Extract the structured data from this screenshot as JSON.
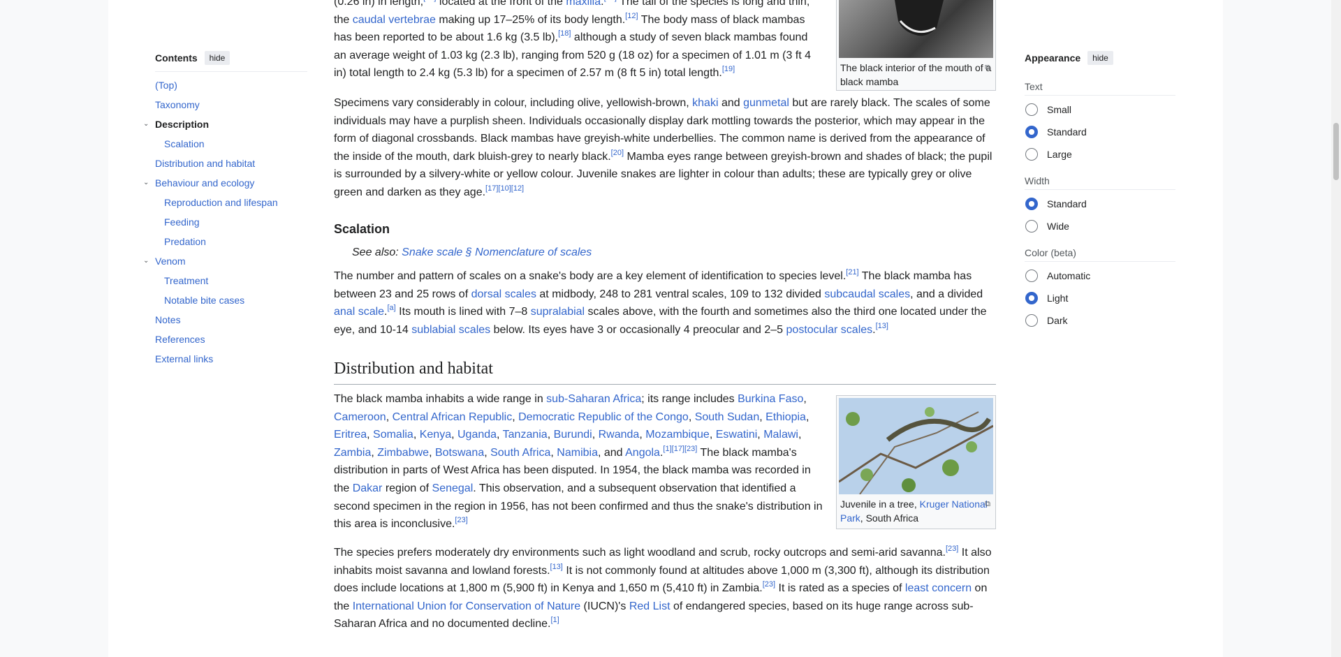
{
  "toc": {
    "title": "Contents",
    "hide": "hide",
    "items": [
      {
        "label": "(Top)",
        "sub": false,
        "active": false,
        "chev": false
      },
      {
        "label": "Taxonomy",
        "sub": false,
        "active": false,
        "chev": false
      },
      {
        "label": "Description",
        "sub": false,
        "active": true,
        "chev": true
      },
      {
        "label": "Scalation",
        "sub": true,
        "active": false,
        "chev": false
      },
      {
        "label": "Distribution and habitat",
        "sub": false,
        "active": false,
        "chev": false
      },
      {
        "label": "Behaviour and ecology",
        "sub": false,
        "active": false,
        "chev": true
      },
      {
        "label": "Reproduction and lifespan",
        "sub": true,
        "active": false,
        "chev": false
      },
      {
        "label": "Feeding",
        "sub": true,
        "active": false,
        "chev": false
      },
      {
        "label": "Predation",
        "sub": true,
        "active": false,
        "chev": false
      },
      {
        "label": "Venom",
        "sub": false,
        "active": false,
        "chev": true
      },
      {
        "label": "Treatment",
        "sub": true,
        "active": false,
        "chev": false
      },
      {
        "label": "Notable bite cases",
        "sub": true,
        "active": false,
        "chev": false
      },
      {
        "label": "Notes",
        "sub": false,
        "active": false,
        "chev": false
      },
      {
        "label": "References",
        "sub": false,
        "active": false,
        "chev": false
      },
      {
        "label": "External links",
        "sub": false,
        "active": false,
        "chev": false
      }
    ]
  },
  "appearance": {
    "title": "Appearance",
    "hide": "hide",
    "sections": [
      {
        "label": "Text",
        "options": [
          {
            "label": "Small",
            "on": false
          },
          {
            "label": "Standard",
            "on": true
          },
          {
            "label": "Large",
            "on": false
          }
        ]
      },
      {
        "label": "Width",
        "options": [
          {
            "label": "Standard",
            "on": true
          },
          {
            "label": "Wide",
            "on": false
          }
        ]
      },
      {
        "label": "Color (beta)",
        "options": [
          {
            "label": "Automatic",
            "on": false
          },
          {
            "label": "Light",
            "on": true
          },
          {
            "label": "Dark",
            "on": false
          }
        ]
      }
    ]
  },
  "figures": {
    "mouth_caption": "The black interior of the mouth of a black mamba",
    "tree_caption_pre": "Juvenile in a tree, ",
    "tree_caption_link": "Kruger National Park",
    "tree_caption_post": ", South Africa"
  },
  "headings": {
    "scalation": "Scalation",
    "distribution": "Distribution and habitat"
  },
  "see_also": {
    "prefix": "See also: ",
    "link": "Snake scale § Nomenclature of scales"
  },
  "paragraphs": [
    [
      {
        "t": "(0.26 in) in length,"
      },
      {
        "s": "[17]"
      },
      {
        "t": " located at the front of the "
      },
      {
        "l": "maxilla"
      },
      {
        "t": "."
      },
      {
        "s": "[16]"
      },
      {
        "t": " The tail of the species is long and thin, the "
      },
      {
        "l": "caudal vertebrae"
      },
      {
        "t": " making up 17–25% of its body length."
      },
      {
        "s": "[12]"
      },
      {
        "t": " The body mass of black mambas has been reported to be about 1.6 kg (3.5 lb),"
      },
      {
        "s": "[18]"
      },
      {
        "t": " although a study of seven black mambas found an average weight of 1.03 kg (2.3 lb), ranging from 520 g (18 oz) for a specimen of 1.01 m (3 ft 4 in) total length to 2.4 kg (5.3 lb) for a specimen of 2.57 m (8 ft 5 in) total length."
      },
      {
        "s": "[19]"
      }
    ],
    [
      {
        "t": "Specimens vary considerably in colour, including olive, yellowish-brown, "
      },
      {
        "l": "khaki"
      },
      {
        "t": " and "
      },
      {
        "l": "gunmetal"
      },
      {
        "t": " but are rarely black. The scales of some individuals may have a purplish sheen. Individuals occasionally display dark mottling towards the posterior, which may appear in the form of diagonal crossbands. Black mambas have greyish-white underbellies. The common name is derived from the appearance of the inside of the mouth, dark bluish-grey to nearly black."
      },
      {
        "s": "[20]"
      },
      {
        "t": " Mamba eyes range between greyish-brown and shades of black; the pupil is surrounded by a silvery-white or yellow colour. Juvenile snakes are lighter in colour than adults; these are typically grey or olive green and darken as they age."
      },
      {
        "s": "[17]"
      },
      {
        "s": "[10]"
      },
      {
        "s": "[12]"
      }
    ],
    [
      {
        "t": "The number and pattern of scales on a snake's body are a key element of identification to species level."
      },
      {
        "s": "[21]"
      },
      {
        "t": " The black mamba has between 23 and 25 rows of "
      },
      {
        "l": "dorsal scales"
      },
      {
        "t": " at midbody, 248 to 281 ventral scales, 109 to 132 divided "
      },
      {
        "l": "subcaudal scales"
      },
      {
        "t": ", and a divided "
      },
      {
        "l": "anal scale"
      },
      {
        "t": "."
      },
      {
        "s": "[a]"
      },
      {
        "t": " Its mouth is lined with 7–8 "
      },
      {
        "l": "supralabial"
      },
      {
        "t": " scales above, with the fourth and sometimes also the third one located under the eye, and 10-14 "
      },
      {
        "l": "sublabial scales"
      },
      {
        "t": " below. Its eyes have 3 or occasionally 4 preocular and 2–5 "
      },
      {
        "l": "postocular scales"
      },
      {
        "t": "."
      },
      {
        "s": "[13]"
      }
    ],
    [
      {
        "t": "The black mamba inhabits a wide range in "
      },
      {
        "l": "sub-Saharan Africa"
      },
      {
        "t": "; its range includes "
      },
      {
        "l": "Burkina Faso"
      },
      {
        "t": ", "
      },
      {
        "l": "Cameroon"
      },
      {
        "t": ", "
      },
      {
        "l": "Central African Republic"
      },
      {
        "t": ", "
      },
      {
        "l": "Democratic Republic of the Congo"
      },
      {
        "t": ", "
      },
      {
        "l": "South Sudan"
      },
      {
        "t": ", "
      },
      {
        "l": "Ethiopia"
      },
      {
        "t": ", "
      },
      {
        "l": "Eritrea"
      },
      {
        "t": ", "
      },
      {
        "l": "Somalia"
      },
      {
        "t": ", "
      },
      {
        "l": "Kenya"
      },
      {
        "t": ", "
      },
      {
        "l": "Uganda"
      },
      {
        "t": ", "
      },
      {
        "l": "Tanzania"
      },
      {
        "t": ", "
      },
      {
        "l": "Burundi"
      },
      {
        "t": ", "
      },
      {
        "l": "Rwanda"
      },
      {
        "t": ", "
      },
      {
        "l": "Mozambique"
      },
      {
        "t": ", "
      },
      {
        "l": "Eswatini"
      },
      {
        "t": ", "
      },
      {
        "l": "Malawi"
      },
      {
        "t": ", "
      },
      {
        "l": "Zambia"
      },
      {
        "t": ", "
      },
      {
        "l": "Zimbabwe"
      },
      {
        "t": ", "
      },
      {
        "l": "Botswana"
      },
      {
        "t": ", "
      },
      {
        "l": "South Africa"
      },
      {
        "t": ", "
      },
      {
        "l": "Namibia"
      },
      {
        "t": ", and "
      },
      {
        "l": "Angola"
      },
      {
        "t": "."
      },
      {
        "s": "[1]"
      },
      {
        "s": "[17]"
      },
      {
        "s": "[23]"
      },
      {
        "t": " The black mamba's distribution in parts of West Africa has been disputed. In 1954, the black mamba was recorded in the "
      },
      {
        "l": "Dakar"
      },
      {
        "t": " region of "
      },
      {
        "l": "Senegal"
      },
      {
        "t": ". This observation, and a subsequent observation that identified a second specimen in the region in 1956, has not been confirmed and thus the snake's distribution in this area is inconclusive."
      },
      {
        "s": "[23]"
      }
    ],
    [
      {
        "t": "The species prefers moderately dry environments such as light woodland and scrub, rocky outcrops and semi-arid savanna."
      },
      {
        "s": "[23]"
      },
      {
        "t": " It also inhabits moist savanna and lowland forests."
      },
      {
        "s": "[13]"
      },
      {
        "t": " It is not commonly found at altitudes above 1,000 m (3,300 ft), although its distribution does include locations at 1,800 m (5,900 ft) in Kenya and 1,650 m (5,410 ft) in Zambia."
      },
      {
        "s": "[23]"
      },
      {
        "t": " It is rated as a species of "
      },
      {
        "l": "least concern"
      },
      {
        "t": " on the "
      },
      {
        "l": "International Union for Conservation of Nature"
      },
      {
        "t": " (IUCN)'s "
      },
      {
        "l": "Red List"
      },
      {
        "t": " of endangered species, based on its huge range across sub-Saharan Africa and no documented decline."
      },
      {
        "s": "[1]"
      }
    ]
  ]
}
